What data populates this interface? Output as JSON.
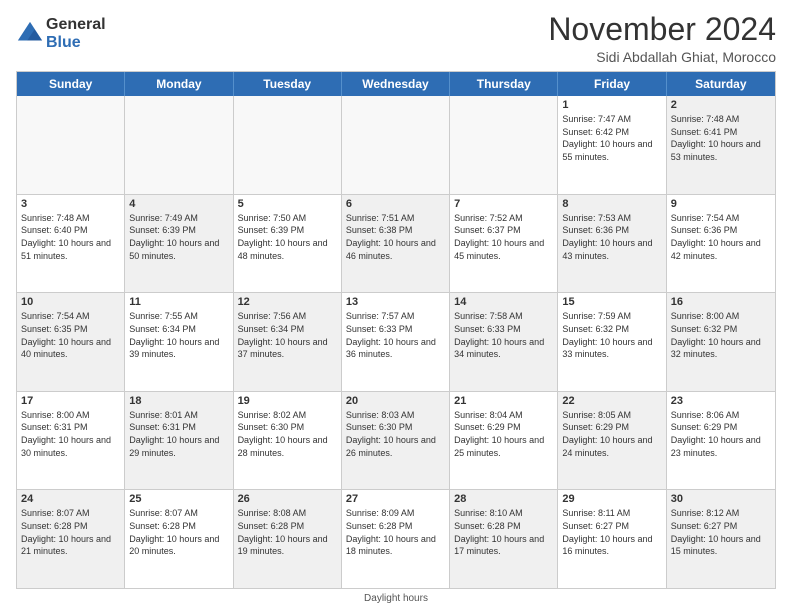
{
  "logo": {
    "line1": "General",
    "line2": "Blue"
  },
  "title": "November 2024",
  "subtitle": "Sidi Abdallah Ghiat, Morocco",
  "days_of_week": [
    "Sunday",
    "Monday",
    "Tuesday",
    "Wednesday",
    "Thursday",
    "Friday",
    "Saturday"
  ],
  "footer": "Daylight hours",
  "weeks": [
    [
      {
        "day": "",
        "info": "",
        "empty": true
      },
      {
        "day": "",
        "info": "",
        "empty": true
      },
      {
        "day": "",
        "info": "",
        "empty": true
      },
      {
        "day": "",
        "info": "",
        "empty": true
      },
      {
        "day": "",
        "info": "",
        "empty": true
      },
      {
        "day": "1",
        "info": "Sunrise: 7:47 AM\nSunset: 6:42 PM\nDaylight: 10 hours and 55 minutes.",
        "empty": false
      },
      {
        "day": "2",
        "info": "Sunrise: 7:48 AM\nSunset: 6:41 PM\nDaylight: 10 hours and 53 minutes.",
        "empty": false,
        "shaded": true
      }
    ],
    [
      {
        "day": "3",
        "info": "Sunrise: 7:48 AM\nSunset: 6:40 PM\nDaylight: 10 hours and 51 minutes.",
        "empty": false
      },
      {
        "day": "4",
        "info": "Sunrise: 7:49 AM\nSunset: 6:39 PM\nDaylight: 10 hours and 50 minutes.",
        "empty": false,
        "shaded": true
      },
      {
        "day": "5",
        "info": "Sunrise: 7:50 AM\nSunset: 6:39 PM\nDaylight: 10 hours and 48 minutes.",
        "empty": false
      },
      {
        "day": "6",
        "info": "Sunrise: 7:51 AM\nSunset: 6:38 PM\nDaylight: 10 hours and 46 minutes.",
        "empty": false,
        "shaded": true
      },
      {
        "day": "7",
        "info": "Sunrise: 7:52 AM\nSunset: 6:37 PM\nDaylight: 10 hours and 45 minutes.",
        "empty": false
      },
      {
        "day": "8",
        "info": "Sunrise: 7:53 AM\nSunset: 6:36 PM\nDaylight: 10 hours and 43 minutes.",
        "empty": false,
        "shaded": true
      },
      {
        "day": "9",
        "info": "Sunrise: 7:54 AM\nSunset: 6:36 PM\nDaylight: 10 hours and 42 minutes.",
        "empty": false
      }
    ],
    [
      {
        "day": "10",
        "info": "Sunrise: 7:54 AM\nSunset: 6:35 PM\nDaylight: 10 hours and 40 minutes.",
        "empty": false,
        "shaded": true
      },
      {
        "day": "11",
        "info": "Sunrise: 7:55 AM\nSunset: 6:34 PM\nDaylight: 10 hours and 39 minutes.",
        "empty": false
      },
      {
        "day": "12",
        "info": "Sunrise: 7:56 AM\nSunset: 6:34 PM\nDaylight: 10 hours and 37 minutes.",
        "empty": false,
        "shaded": true
      },
      {
        "day": "13",
        "info": "Sunrise: 7:57 AM\nSunset: 6:33 PM\nDaylight: 10 hours and 36 minutes.",
        "empty": false
      },
      {
        "day": "14",
        "info": "Sunrise: 7:58 AM\nSunset: 6:33 PM\nDaylight: 10 hours and 34 minutes.",
        "empty": false,
        "shaded": true
      },
      {
        "day": "15",
        "info": "Sunrise: 7:59 AM\nSunset: 6:32 PM\nDaylight: 10 hours and 33 minutes.",
        "empty": false
      },
      {
        "day": "16",
        "info": "Sunrise: 8:00 AM\nSunset: 6:32 PM\nDaylight: 10 hours and 32 minutes.",
        "empty": false,
        "shaded": true
      }
    ],
    [
      {
        "day": "17",
        "info": "Sunrise: 8:00 AM\nSunset: 6:31 PM\nDaylight: 10 hours and 30 minutes.",
        "empty": false
      },
      {
        "day": "18",
        "info": "Sunrise: 8:01 AM\nSunset: 6:31 PM\nDaylight: 10 hours and 29 minutes.",
        "empty": false,
        "shaded": true
      },
      {
        "day": "19",
        "info": "Sunrise: 8:02 AM\nSunset: 6:30 PM\nDaylight: 10 hours and 28 minutes.",
        "empty": false
      },
      {
        "day": "20",
        "info": "Sunrise: 8:03 AM\nSunset: 6:30 PM\nDaylight: 10 hours and 26 minutes.",
        "empty": false,
        "shaded": true
      },
      {
        "day": "21",
        "info": "Sunrise: 8:04 AM\nSunset: 6:29 PM\nDaylight: 10 hours and 25 minutes.",
        "empty": false
      },
      {
        "day": "22",
        "info": "Sunrise: 8:05 AM\nSunset: 6:29 PM\nDaylight: 10 hours and 24 minutes.",
        "empty": false,
        "shaded": true
      },
      {
        "day": "23",
        "info": "Sunrise: 8:06 AM\nSunset: 6:29 PM\nDaylight: 10 hours and 23 minutes.",
        "empty": false
      }
    ],
    [
      {
        "day": "24",
        "info": "Sunrise: 8:07 AM\nSunset: 6:28 PM\nDaylight: 10 hours and 21 minutes.",
        "empty": false,
        "shaded": true
      },
      {
        "day": "25",
        "info": "Sunrise: 8:07 AM\nSunset: 6:28 PM\nDaylight: 10 hours and 20 minutes.",
        "empty": false
      },
      {
        "day": "26",
        "info": "Sunrise: 8:08 AM\nSunset: 6:28 PM\nDaylight: 10 hours and 19 minutes.",
        "empty": false,
        "shaded": true
      },
      {
        "day": "27",
        "info": "Sunrise: 8:09 AM\nSunset: 6:28 PM\nDaylight: 10 hours and 18 minutes.",
        "empty": false
      },
      {
        "day": "28",
        "info": "Sunrise: 8:10 AM\nSunset: 6:28 PM\nDaylight: 10 hours and 17 minutes.",
        "empty": false,
        "shaded": true
      },
      {
        "day": "29",
        "info": "Sunrise: 8:11 AM\nSunset: 6:27 PM\nDaylight: 10 hours and 16 minutes.",
        "empty": false
      },
      {
        "day": "30",
        "info": "Sunrise: 8:12 AM\nSunset: 6:27 PM\nDaylight: 10 hours and 15 minutes.",
        "empty": false,
        "shaded": true
      }
    ]
  ]
}
